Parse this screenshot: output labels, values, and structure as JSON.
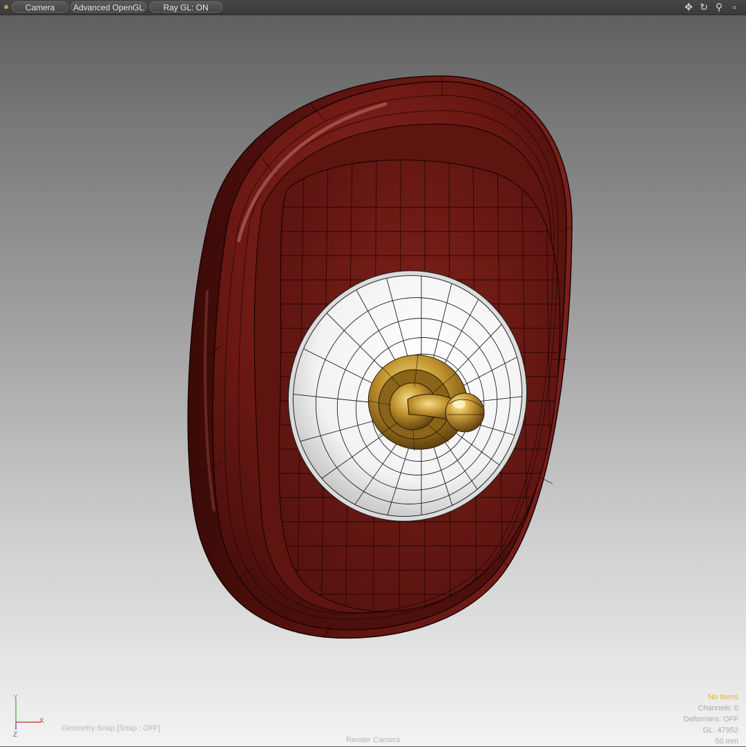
{
  "toolbar": {
    "camera_label": "Camera",
    "opengl_label": "Advanced OpenGL",
    "raygl_label": "Ray GL: ON",
    "icons": [
      "move-icon",
      "rotate-icon",
      "zoom-icon",
      "maximize-icon"
    ]
  },
  "hud": {
    "selection": "No Items",
    "channels": "Channels: 0",
    "deformers": "Deformers: OFF",
    "gl": "GL: 47952",
    "focal": "50 mm",
    "snap": "Geometry Snap  [Snap : OFF]",
    "view": "Render Camera"
  },
  "axes": {
    "y": "Y",
    "x": "X",
    "z": "Z"
  },
  "colors": {
    "wood": "#6e1a16",
    "porcelain": "#f4f4f4",
    "brass": "#b58a2a",
    "hud_highlight": "#e2b338"
  }
}
